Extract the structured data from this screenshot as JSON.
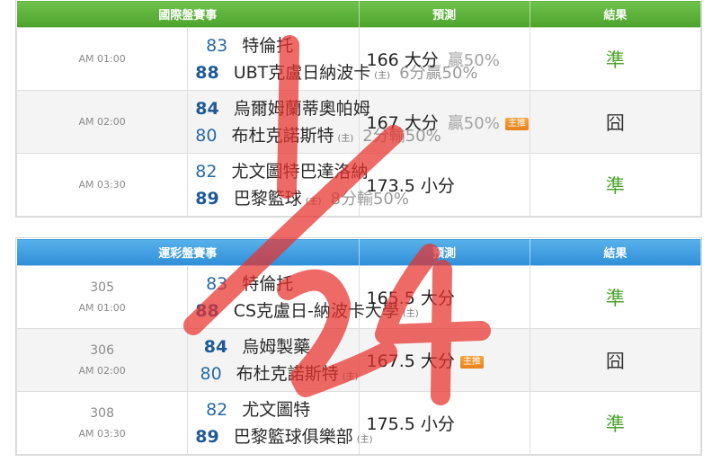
{
  "international": {
    "header": {
      "match": "國際盤賽事",
      "predict": "預測",
      "result": "結果"
    },
    "rows": [
      {
        "time": "AM 01:00",
        "away_score": "83",
        "away_team": "特倫托",
        "home_score": "88",
        "home_team": "UBT克盧日納波卡",
        "home_tag": "(主)",
        "home_tail": "6分贏50%",
        "prediction": "166 大分",
        "extra": "贏50%",
        "badge": "",
        "result": "準",
        "result_type": "ok"
      },
      {
        "time": "AM 02:00",
        "away_score": "84",
        "away_team": "烏爾姆蘭蒂奧帕姆",
        "home_score": "80",
        "home_team": "布杜克諾斯特",
        "home_tag": "(主)",
        "home_tail": "2分輸50%",
        "prediction": "167 大分",
        "extra": "贏50%",
        "badge": "主推",
        "result": "囧",
        "result_type": "bad"
      },
      {
        "time": "AM 03:30",
        "away_score": "82",
        "away_team": "尤文圖特巴達洛納",
        "home_score": "89",
        "home_team": "巴黎籃球",
        "home_tag": "(主)",
        "home_tail": "8分輸50%",
        "prediction": "173.5 小分",
        "extra": "",
        "badge": "",
        "result": "準",
        "result_type": "ok"
      }
    ]
  },
  "lottery": {
    "header": {
      "match": "運彩盤賽事",
      "predict": "預測",
      "result": "結果"
    },
    "rows": [
      {
        "code": "305",
        "time": "AM 01:00",
        "away_score": "83",
        "away_team": "特倫托",
        "home_score": "88",
        "home_team": "CS克盧日-納波卡大學",
        "home_tag": "(主)",
        "prediction": "165.5 大分",
        "badge": "",
        "result": "準",
        "result_type": "ok"
      },
      {
        "code": "306",
        "time": "AM 02:00",
        "away_score": "84",
        "away_team": "烏姆製藥",
        "home_score": "80",
        "home_team": "布杜克諾斯特",
        "home_tag": "(主)",
        "prediction": "167.5 大分",
        "badge": "主推",
        "result": "囧",
        "result_type": "bad"
      },
      {
        "code": "308",
        "time": "AM 03:30",
        "away_score": "82",
        "away_team": "尤文圖特",
        "home_score": "89",
        "home_team": "巴黎籃球俱樂部",
        "home_tag": "(主)",
        "prediction": "175.5 小分",
        "badge": "",
        "result": "準",
        "result_type": "ok"
      }
    ]
  },
  "annotation": {
    "color": "#e8322e"
  }
}
